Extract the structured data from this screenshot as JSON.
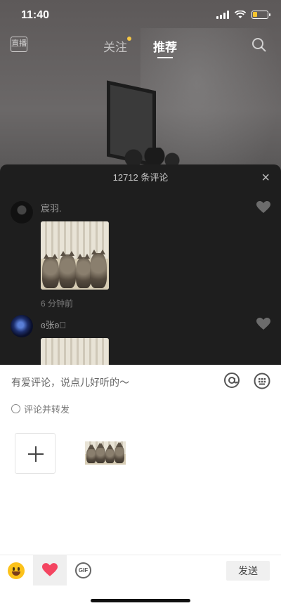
{
  "status_bar": {
    "time": "11:40"
  },
  "top_nav": {
    "live_label": "直播",
    "tabs": [
      {
        "label": "关注"
      },
      {
        "label": "推荐"
      }
    ]
  },
  "comments_panel": {
    "title": "12712 条评论",
    "close_label": "×",
    "comments": [
      {
        "user": "宸羽.",
        "time": "6 分钟前"
      },
      {
        "user": "ɞ张ʚ゙"
      }
    ]
  },
  "composer": {
    "placeholder": "有爱评论，说点儿好听的～",
    "repost_label": "评论并转发",
    "send_label": "发送",
    "gif_label": "GIF"
  },
  "colors": {
    "accent_heart": "#f44561",
    "notification_dot": "#f6c744",
    "battery": "#f4c430"
  }
}
